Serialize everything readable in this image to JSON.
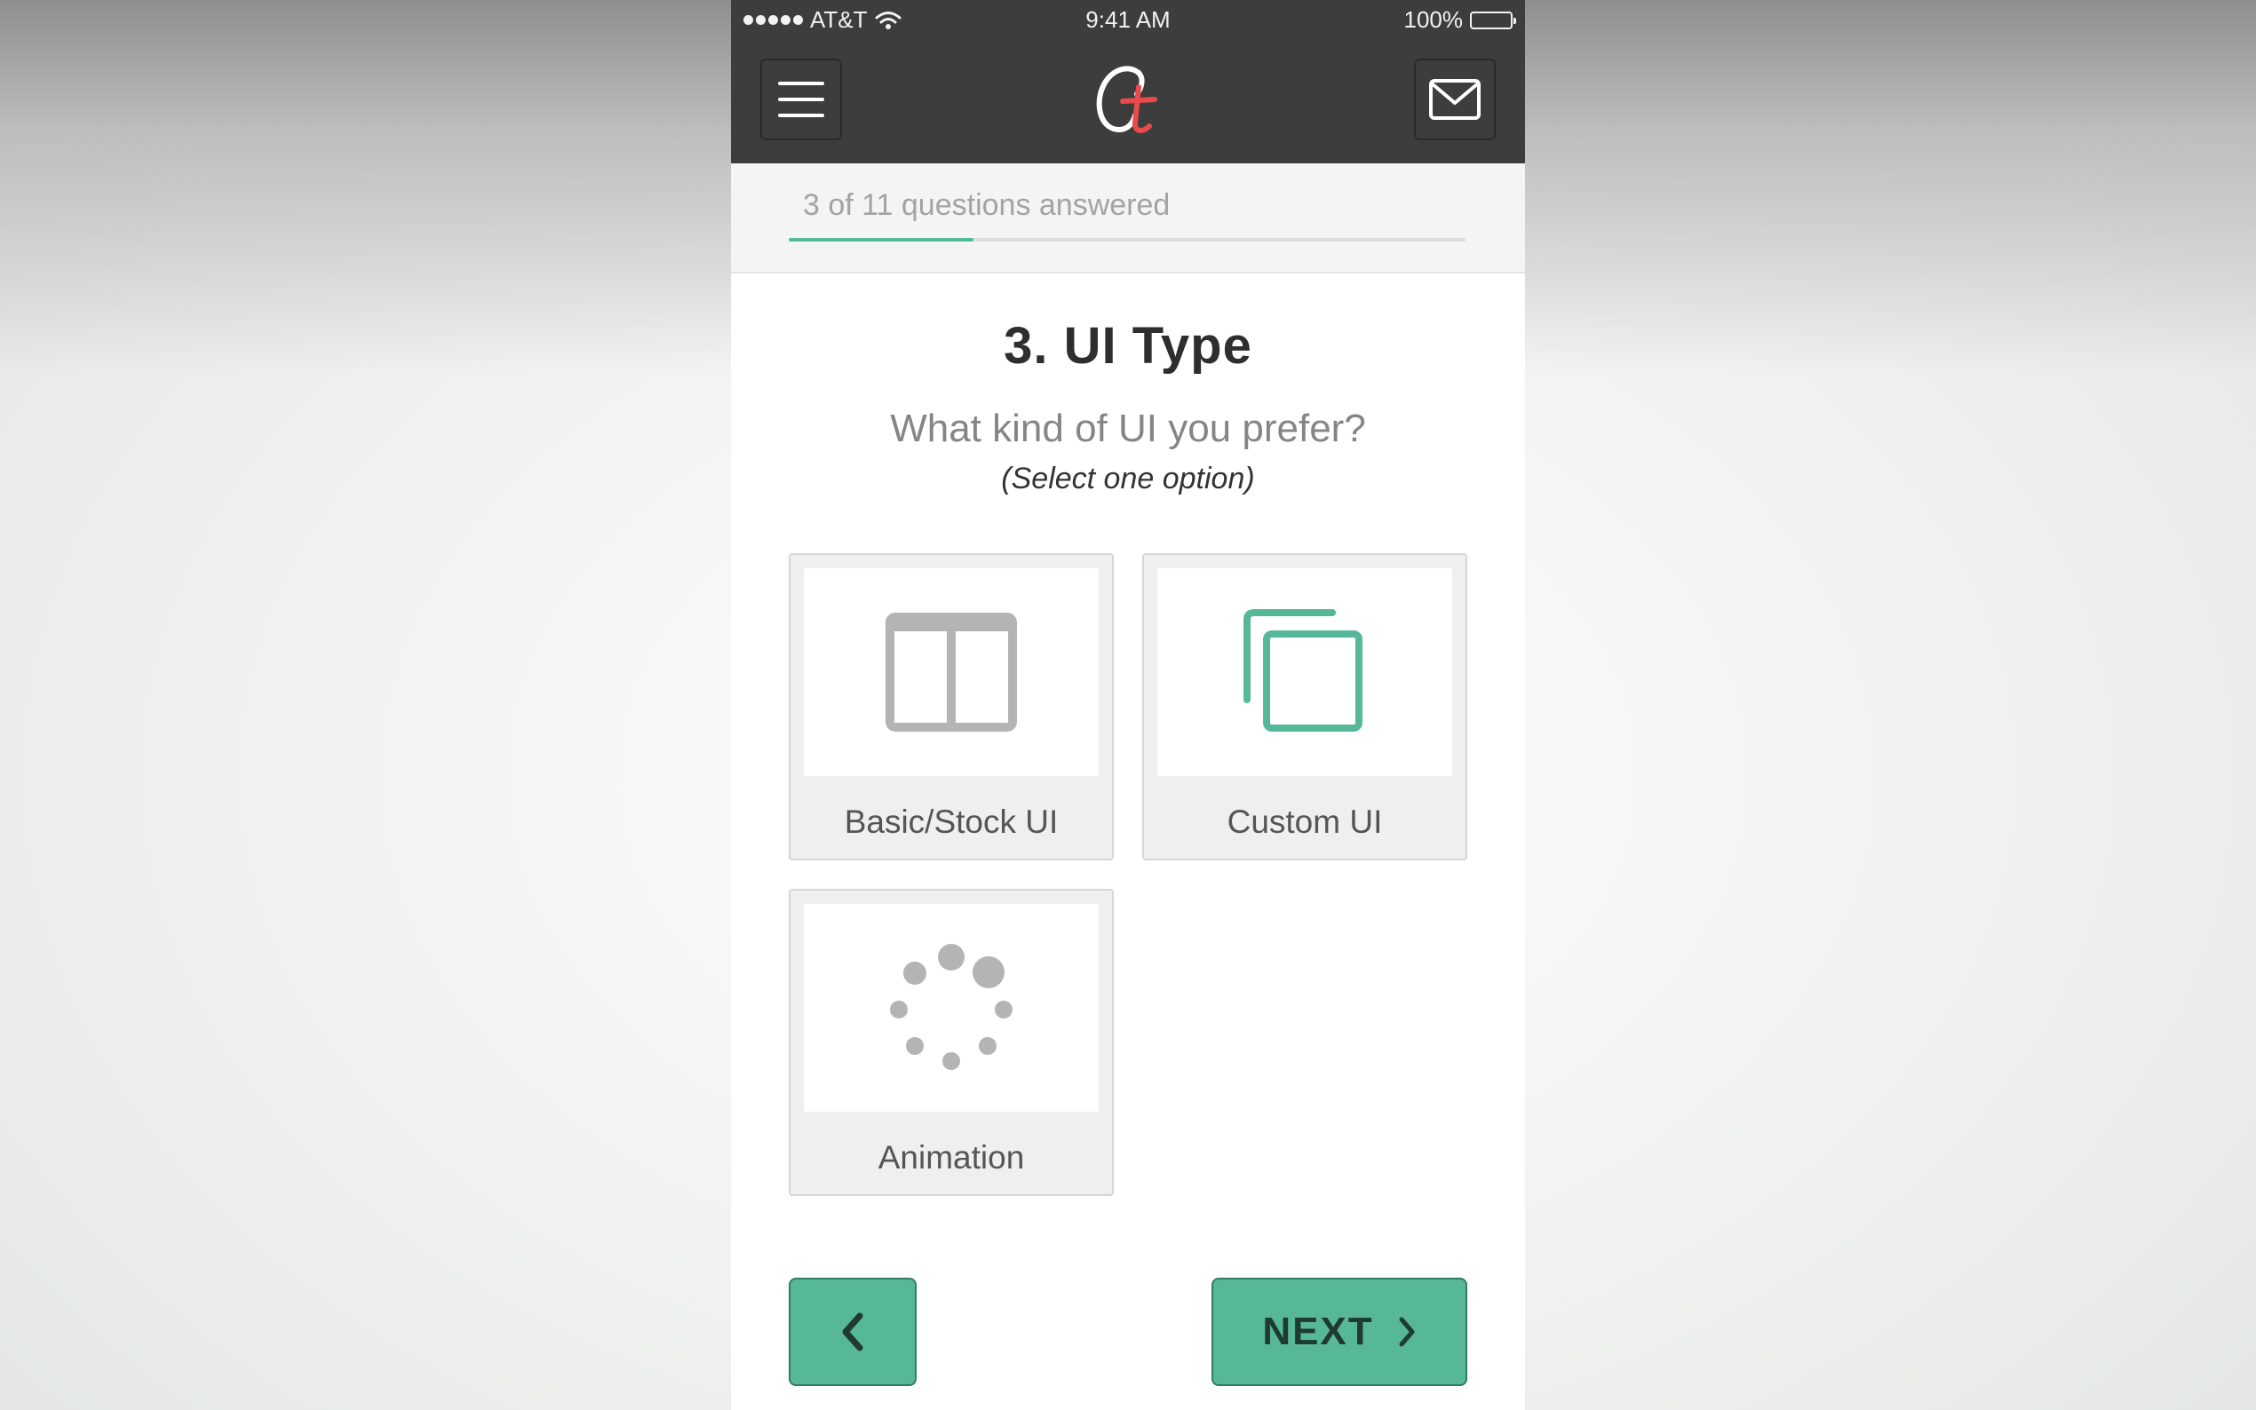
{
  "status_bar": {
    "carrier": "AT&T",
    "time": "9:41 AM",
    "battery": "100%"
  },
  "nav": {
    "menu_icon": "hamburger-menu-icon",
    "logo_icon": "brand-logo-icon",
    "mail_icon": "envelope-icon"
  },
  "progress": {
    "text": "3 of 11 questions answered",
    "answered": 3,
    "total": 11
  },
  "question": {
    "title": "3. UI Type",
    "subtitle": "What kind of UI you prefer?",
    "hint": "(Select one option)"
  },
  "options": [
    {
      "label": "Basic/Stock UI",
      "icon": "split-panel-icon"
    },
    {
      "label": "Custom UI",
      "icon": "overlapping-squares-icon"
    },
    {
      "label": "Animation",
      "icon": "loading-spinner-icon"
    }
  ],
  "buttons": {
    "next_label": "NEXT",
    "back_icon": "chevron-left-icon",
    "next_icon": "chevron-right-icon"
  },
  "colors": {
    "accent": "#56b896",
    "navbar": "#3d3d3d",
    "logo_red": "#e94b4b"
  }
}
